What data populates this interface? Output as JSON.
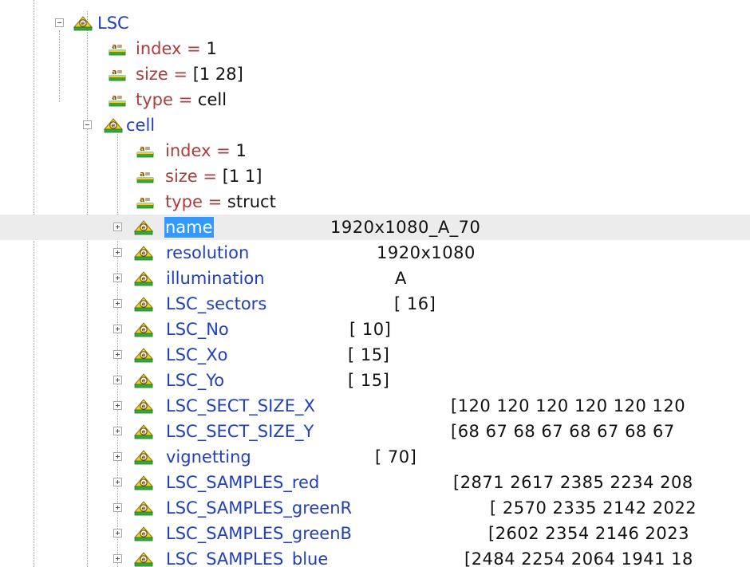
{
  "tree": {
    "root": {
      "label": "LSC",
      "children_meta": [
        {
          "name": "index",
          "equals": "=",
          "value": "1"
        },
        {
          "name": "size",
          "equals": "=",
          "value": "[1 28]"
        },
        {
          "name": "type",
          "equals": "=",
          "value": "cell"
        }
      ],
      "cell": {
        "label": "cell",
        "meta": [
          {
            "name": "index",
            "equals": "=",
            "value": "1"
          },
          {
            "name": "size",
            "equals": "=",
            "value": "[1 1]"
          },
          {
            "name": "type",
            "equals": "=",
            "value": "struct"
          }
        ],
        "fields": [
          {
            "name": "name",
            "value": "1920x1080_A_70"
          },
          {
            "name": "resolution",
            "value": "1920x1080"
          },
          {
            "name": "illumination",
            "value": "A"
          },
          {
            "name": "LSC_sectors",
            "value": "[ 16]"
          },
          {
            "name": "LSC_No",
            "value": "[ 10]"
          },
          {
            "name": "LSC_Xo",
            "value": "[ 15]"
          },
          {
            "name": "LSC_Yo",
            "value": "[ 15]"
          },
          {
            "name": "LSC_SECT_SIZE_X",
            "value": "[120  120  120  120  120  120"
          },
          {
            "name": "LSC_SECT_SIZE_Y",
            "value": "[68  67  68  67  68  67  68  67"
          },
          {
            "name": "vignetting",
            "value": "[ 70]"
          },
          {
            "name": "LSC_SAMPLES_red",
            "value": "[2871  2617  2385  2234  208"
          },
          {
            "name": "LSC_SAMPLES_greenR",
            "value": "[ 2570  2335  2142  2022"
          },
          {
            "name": "LSC_SAMPLES_greenB",
            "value": "[2602  2354  2146  2023"
          },
          {
            "name": "LSC_SAMPLES_blue",
            "value": "[2484  2254  2064  1941  18"
          }
        ]
      }
    },
    "selected_field": "name",
    "colors": {
      "leaf_text": "#b23a3a",
      "node_text": "#1f3fbf",
      "selection_bg": "#3399ff",
      "selected_row_bg": "#ececec",
      "icon_green": "#3aa53a",
      "icon_yellow": "#f2d21b"
    },
    "icons": {
      "struct": "struct-node-icon",
      "leaf": "leaf-attribute-icon",
      "expand": "expand-plus-icon",
      "collapse": "collapse-minus-icon"
    }
  }
}
